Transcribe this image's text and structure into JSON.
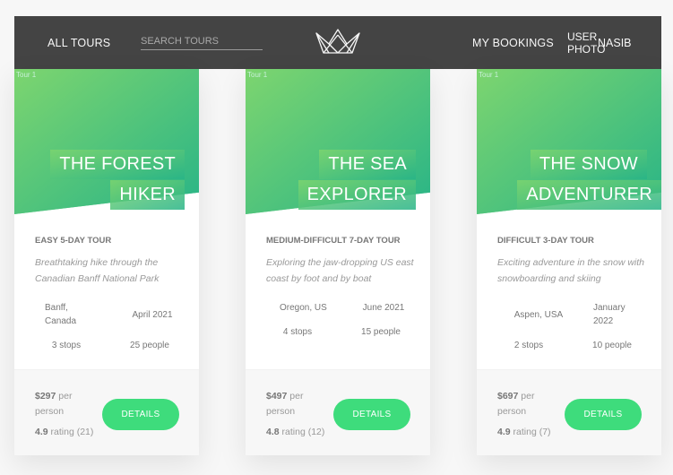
{
  "header": {
    "all_tours": "All tours",
    "search_placeholder": "Search tours",
    "my_bookings": "My bookings",
    "user_photo_alt": "User photo",
    "user_name": "Nasib"
  },
  "tours": [
    {
      "image_alt": "Tour 1",
      "title_lines": [
        "The Forest",
        "Hiker"
      ],
      "heading": "Easy 5-day tour",
      "summary": "Breathtaking hike through the Canadian Banff National Park",
      "location": "Banff, Canada",
      "date": "April 2021",
      "stops": "3 stops",
      "people": "25 people",
      "price": "$297",
      "price_unit": "per person",
      "rating": "4.9",
      "rating_label": "rating (21)",
      "button": "Details"
    },
    {
      "image_alt": "Tour 1",
      "title_lines": [
        "The Sea",
        "Explorer"
      ],
      "heading": "Medium-difficult 7-day tour",
      "summary": "Exploring the jaw-dropping US east coast by foot and by boat",
      "location": "Oregon, US",
      "date": "June 2021",
      "stops": "4 stops",
      "people": "15 people",
      "price": "$497",
      "price_unit": "per person",
      "rating": "4.8",
      "rating_label": "rating (12)",
      "button": "Details"
    },
    {
      "image_alt": "Tour 1",
      "title_lines": [
        "The Snow",
        "Adventurer"
      ],
      "heading": "Difficult 3-day tour",
      "summary": "Exciting adventure in the snow with snowboarding and skiing",
      "location": "Aspen, USA",
      "date": "January 2022",
      "stops": "2 stops",
      "people": "10 people",
      "price": "$697",
      "price_unit": "per person",
      "rating": "4.9",
      "rating_label": "rating (7)",
      "button": "Details"
    }
  ],
  "colors": {
    "header_bg": "#444444",
    "accent_green": "#3edc7c",
    "gradient_start": "#7dd56f",
    "gradient_end": "#28b487"
  }
}
